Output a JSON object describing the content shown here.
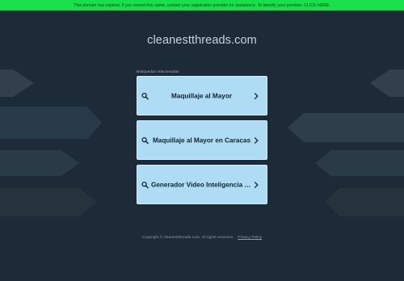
{
  "banner": {
    "text": "This domain has expired. If you owned this name, contact your registration provider for assistance. To identify your provider, CLICK HERE."
  },
  "page": {
    "domain": "cleanestthreads.com",
    "related_label": "Búsquedas relacionadas"
  },
  "related_links": [
    {
      "label": "Maquillaje al Mayor",
      "icon": "search-icon"
    },
    {
      "label": "Maquillaje al Mayor en Caracas",
      "icon": "search-icon"
    },
    {
      "label": "Generador Video Inteligencia Artificial",
      "icon": "search-icon"
    }
  ],
  "footer": {
    "copyright": "Copyright © cleanestthreads.com.  All rights reserved.",
    "privacy": "Privacy Policy"
  },
  "colors": {
    "background": "#1d2b38",
    "banner": "#18e04a",
    "link_box": "#aedcf5"
  }
}
